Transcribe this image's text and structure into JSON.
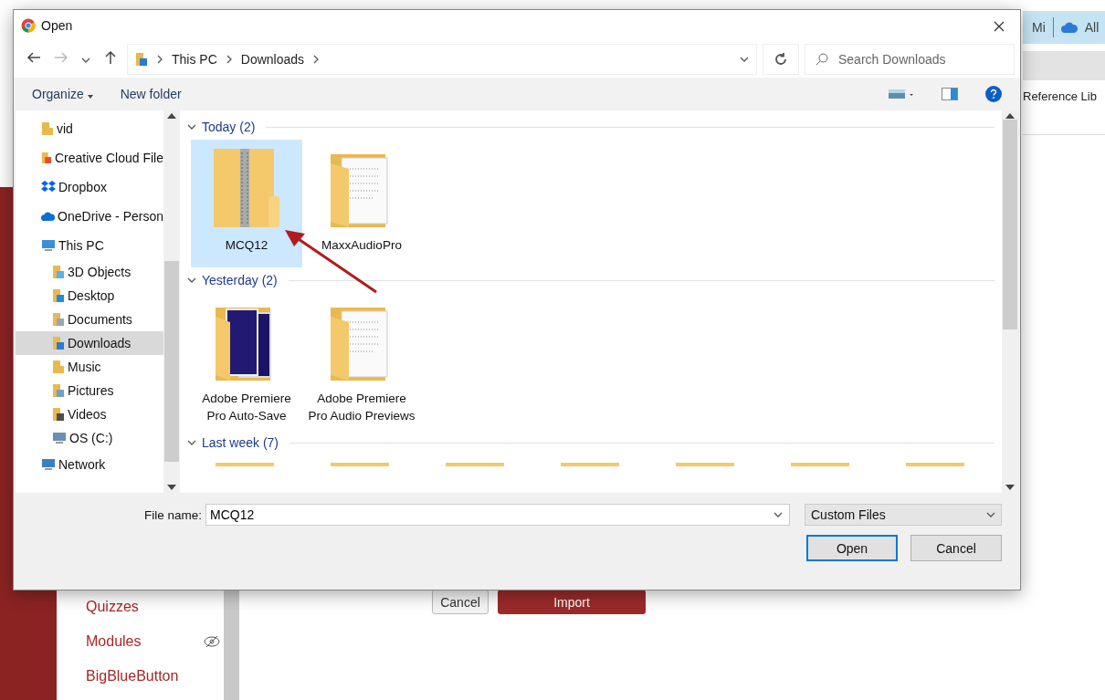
{
  "page": {
    "top_bar": [
      "Mi",
      "All"
    ],
    "reference": "Reference Lib",
    "course_nav": [
      {
        "label": "Quizzes",
        "hidden": false
      },
      {
        "label": "Modules",
        "hidden": true
      },
      {
        "label": "BigBlueButton",
        "hidden": false
      }
    ],
    "actions": [
      {
        "label": "Cancel",
        "kind": "secondary"
      },
      {
        "label": "Import",
        "kind": "primary"
      }
    ]
  },
  "dialog": {
    "title": "Open",
    "breadcrumb": [
      "This PC",
      "Downloads"
    ],
    "search": {
      "placeholder": "Search Downloads"
    },
    "toolbar": {
      "organize": "Organize",
      "new_folder": "New folder"
    },
    "nav": [
      {
        "label": "vid",
        "kind": "folder",
        "selected": false
      },
      {
        "label": "Creative Cloud File",
        "kind": "cc",
        "selected": false
      },
      {
        "label": "Dropbox",
        "kind": "dropbox",
        "selected": false
      },
      {
        "label": "OneDrive - Person",
        "kind": "onedrive",
        "selected": false
      },
      {
        "label": "This PC",
        "kind": "pc",
        "selected": false,
        "children": [
          {
            "label": "3D Objects",
            "kind": "objects",
            "selected": false
          },
          {
            "label": "Desktop",
            "kind": "desktop",
            "selected": false
          },
          {
            "label": "Documents",
            "kind": "documents",
            "selected": false
          },
          {
            "label": "Downloads",
            "kind": "downloads",
            "selected": true
          },
          {
            "label": "Music",
            "kind": "music",
            "selected": false
          },
          {
            "label": "Pictures",
            "kind": "pictures",
            "selected": false
          },
          {
            "label": "Videos",
            "kind": "videos",
            "selected": false
          },
          {
            "label": "OS (C:)",
            "kind": "drive",
            "selected": false
          }
        ]
      },
      {
        "label": "Network",
        "kind": "network",
        "selected": false
      }
    ],
    "groups": [
      {
        "label": "Today (2)",
        "expanded": true,
        "items": [
          {
            "label": "MCQ12",
            "kind": "zip",
            "selected": true
          },
          {
            "label": "MaxxAudioPro",
            "kind": "docfolder",
            "selected": false
          }
        ]
      },
      {
        "label": "Yesterday (2)",
        "expanded": true,
        "items": [
          {
            "label": "Adobe Premiere Pro Auto-Save",
            "kind": "premiere",
            "selected": false
          },
          {
            "label": "Adobe Premiere Pro Audio Previews",
            "kind": "docfolder",
            "selected": false
          }
        ]
      },
      {
        "label": "Last week (7)",
        "expanded": true,
        "items": [
          {
            "kind": "peek",
            "selected": false
          },
          {
            "kind": "peek",
            "selected": false
          },
          {
            "kind": "peek",
            "selected": false
          },
          {
            "kind": "peek",
            "selected": false
          },
          {
            "kind": "peek",
            "selected": false
          },
          {
            "kind": "peek",
            "selected": false
          },
          {
            "kind": "peek",
            "selected": false
          }
        ]
      }
    ],
    "file_name": {
      "label": "File name:",
      "value": "MCQ12"
    },
    "filter": "Custom Files",
    "buttons": [
      {
        "label": "Open",
        "default": true
      },
      {
        "label": "Cancel",
        "default": false
      }
    ]
  }
}
